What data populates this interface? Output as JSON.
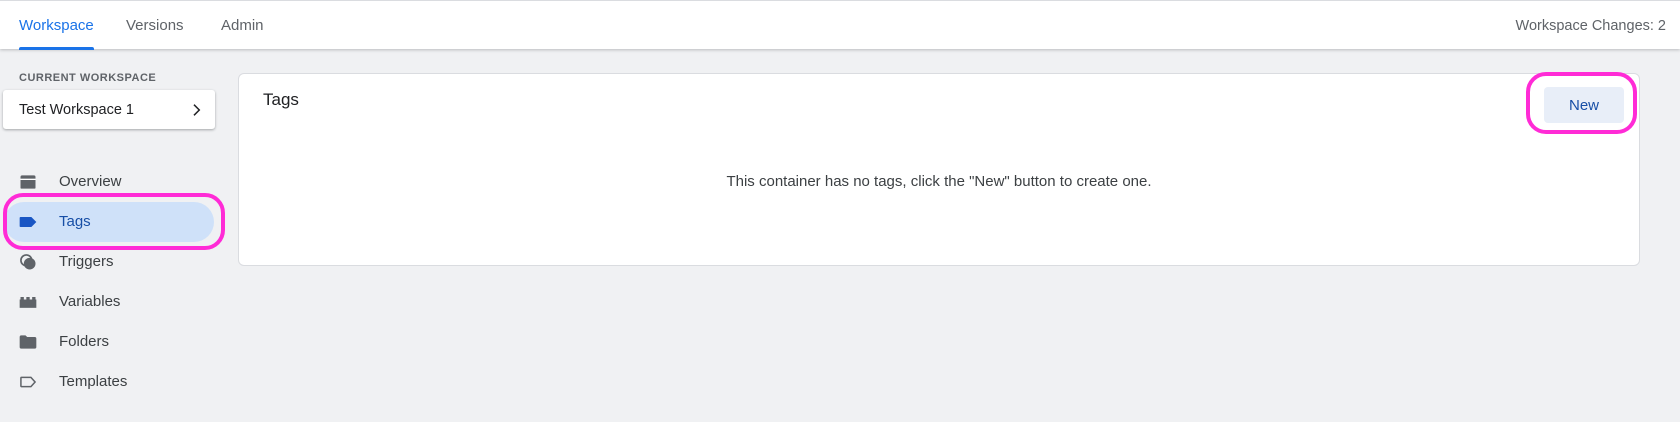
{
  "header": {
    "tabs": [
      {
        "label": "Workspace",
        "active": true
      },
      {
        "label": "Versions",
        "active": false
      },
      {
        "label": "Admin",
        "active": false
      }
    ],
    "changes_text": "Workspace Changes: 2"
  },
  "sidebar": {
    "workspace_label": "CURRENT WORKSPACE",
    "workspace_name": "Test Workspace 1",
    "items": [
      {
        "label": "Overview",
        "icon": "overview-icon",
        "active": false
      },
      {
        "label": "Tags",
        "icon": "tag-icon",
        "active": true
      },
      {
        "label": "Triggers",
        "icon": "triggers-icon",
        "active": false
      },
      {
        "label": "Variables",
        "icon": "variables-icon",
        "active": false
      },
      {
        "label": "Folders",
        "icon": "folder-icon",
        "active": false
      },
      {
        "label": "Templates",
        "icon": "template-icon",
        "active": false
      }
    ]
  },
  "main": {
    "card_title": "Tags",
    "new_button": "New",
    "empty_message": "This container has no tags, click the \"New\" button to create one."
  },
  "colors": {
    "accent": "#1a73e8",
    "highlight": "#ff2bd6",
    "active_nav_bg": "#cfe1f9"
  }
}
